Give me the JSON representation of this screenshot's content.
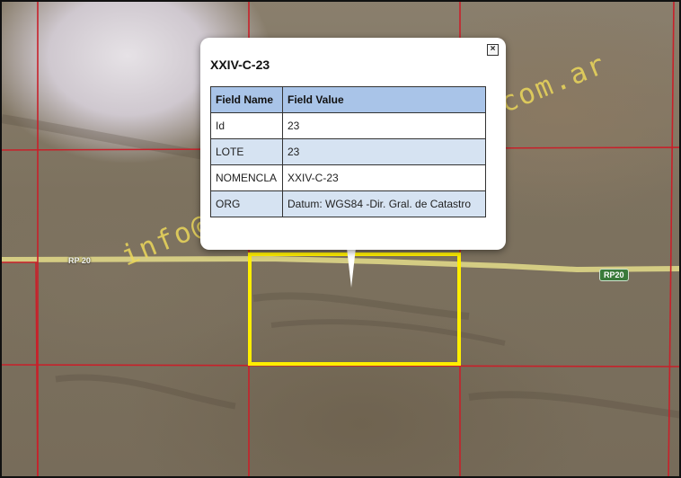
{
  "popup": {
    "title": "XXIV-C-23",
    "close_glyph": "×",
    "headers": {
      "name": "Field Name",
      "value": "Field Value"
    },
    "rows": [
      {
        "name": "Id",
        "value": "23"
      },
      {
        "name": "LOTE",
        "value": "23"
      },
      {
        "name": "NOMENCLA",
        "value": "XXIV-C-23"
      },
      {
        "name": "ORG",
        "value": "Datum: WGS84 -Dir. Gral. de Catastro"
      }
    ]
  },
  "roads": {
    "label_left": "RP 20",
    "label_right": "RP20"
  },
  "watermark": "info@estanciasycampos.com.ar",
  "colors": {
    "grid_line": "#c8202a",
    "parcel_highlight": "#ffee00",
    "road": "#e4dc8a",
    "header_bg": "#a9c4e8",
    "row_alt_bg": "#d6e3f2"
  }
}
